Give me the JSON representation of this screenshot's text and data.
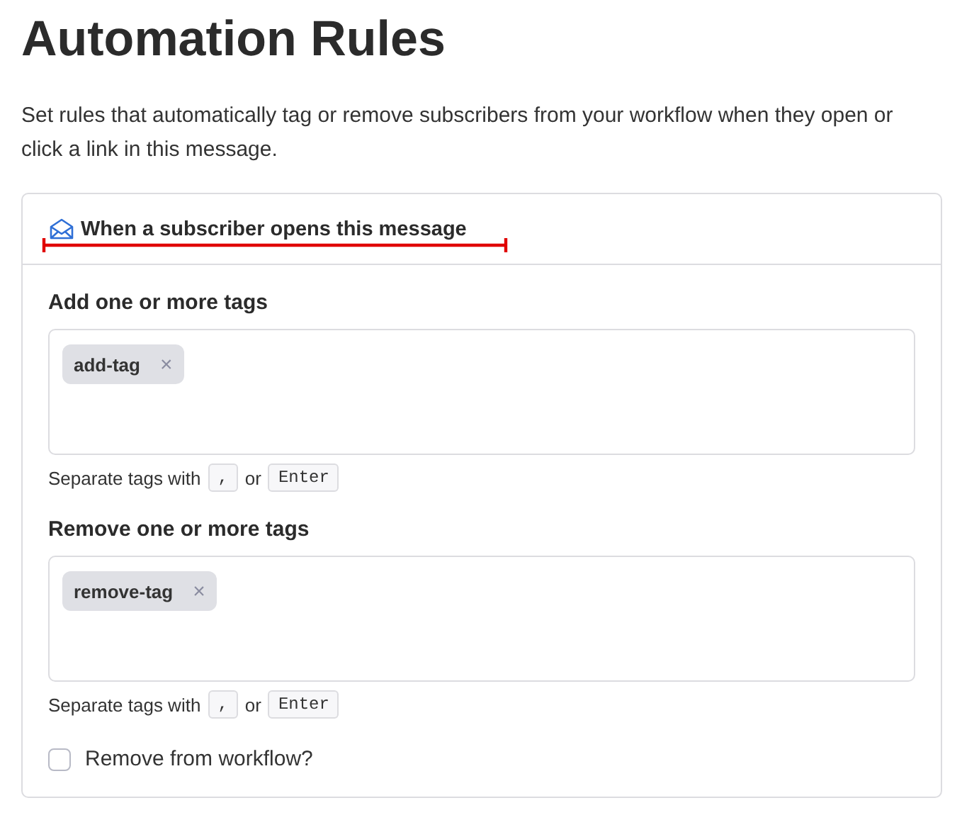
{
  "page": {
    "title": "Automation Rules",
    "description": "Set rules that automatically tag or remove subscribers from your workflow when they open or click a link in this message."
  },
  "card": {
    "header": "When a subscriber opens this message",
    "sections": [
      {
        "label": "Add one or more tags",
        "tags": [
          {
            "text": "add-tag",
            "remove": "×"
          }
        ],
        "help": [
          "Separate tags with",
          ",",
          "or",
          "Enter"
        ]
      },
      {
        "label": "Remove one or more tags",
        "tags": [
          {
            "text": "remove-tag",
            "remove": "×"
          }
        ],
        "help": [
          "Separate tags with",
          ",",
          "or",
          "Enter"
        ]
      }
    ],
    "checkbox": {
      "label": "Remove from workflow?",
      "checked": false
    }
  }
}
